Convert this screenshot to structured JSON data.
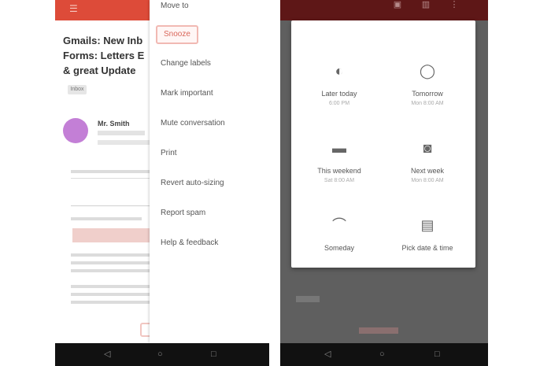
{
  "left_phone": {
    "appbar": {
      "icon": "hamburger-menu-icon",
      "color": "#dd4b39"
    },
    "email": {
      "subject_lines": [
        "Gmails: New Inb",
        "Forms: Letters E",
        "& great Update"
      ],
      "label": "Inbox",
      "sender": "Mr. Smith",
      "avatar_color": "#c37fd6"
    },
    "menu": {
      "items": [
        {
          "label": "Move to",
          "selected": false
        },
        {
          "label": "Snooze",
          "selected": true
        },
        {
          "label": "Change labels",
          "selected": false
        },
        {
          "label": "Mark important",
          "selected": false
        },
        {
          "label": "Mute conversation",
          "selected": false
        },
        {
          "label": "Print",
          "selected": false
        },
        {
          "label": "Revert auto-sizing",
          "selected": false
        },
        {
          "label": "Report spam",
          "selected": false
        },
        {
          "label": "Help & feedback",
          "selected": false
        }
      ]
    }
  },
  "right_phone": {
    "appbar_color": "#5e1717",
    "appbar_icons": [
      "archive-icon",
      "delete-icon",
      "more-icon"
    ],
    "dialog": {
      "options": [
        {
          "title": "Later today",
          "subtitle": "6:00 PM",
          "icon": "clock-icon"
        },
        {
          "title": "Tomorrow",
          "subtitle": "Mon 8:00 AM",
          "icon": "sun-icon"
        },
        {
          "title": "This weekend",
          "subtitle": "Sat 8:00 AM",
          "icon": "sofa-icon"
        },
        {
          "title": "Next week",
          "subtitle": "Mon 8:00 AM",
          "icon": "briefcase-icon"
        },
        {
          "title": "Someday",
          "subtitle": "",
          "icon": "rainbow-icon"
        },
        {
          "title": "Pick date & time",
          "subtitle": "",
          "icon": "calendar-icon"
        }
      ]
    }
  }
}
